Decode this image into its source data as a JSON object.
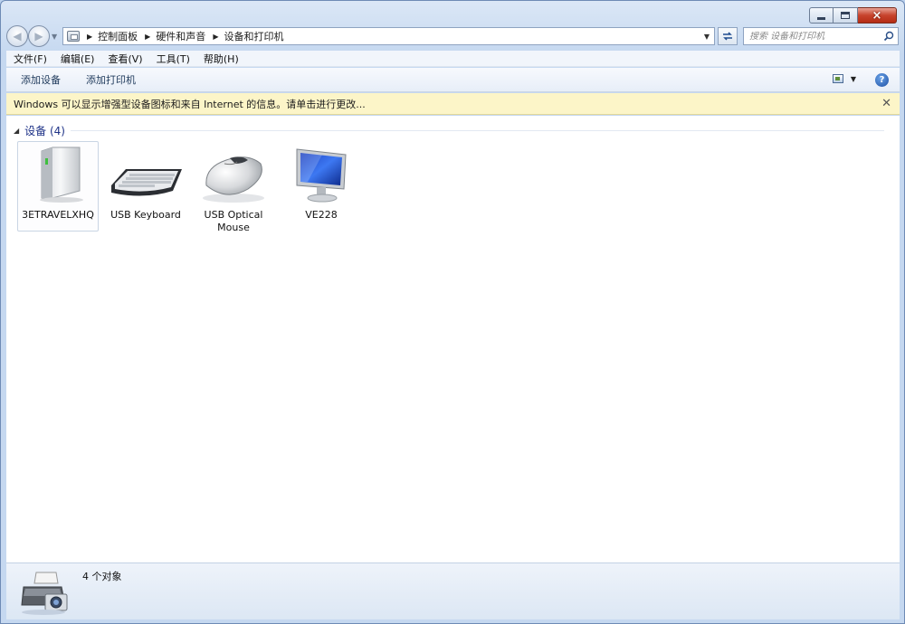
{
  "window": {
    "controls": {
      "minimize": "minimize",
      "maximize": "maximize",
      "close": "×"
    }
  },
  "address": {
    "breadcrumbs": [
      "控制面板",
      "硬件和声音",
      "设备和打印机"
    ],
    "search_placeholder": "搜索 设备和打印机"
  },
  "menu": {
    "items": [
      "文件(F)",
      "编辑(E)",
      "查看(V)",
      "工具(T)",
      "帮助(H)"
    ]
  },
  "commands": {
    "add_device": "添加设备",
    "add_printer": "添加打印机"
  },
  "info_bar": {
    "text": "Windows 可以显示增强型设备图标和来自 Internet 的信息。请单击进行更改..."
  },
  "group": {
    "title": "设备 (4)"
  },
  "devices": [
    {
      "label": "3ETRAVELXHQ",
      "icon": "external-drive-icon",
      "selected": true
    },
    {
      "label": "USB Keyboard",
      "icon": "keyboard-icon",
      "selected": false
    },
    {
      "label": "USB Optical Mouse",
      "icon": "mouse-icon",
      "selected": false
    },
    {
      "label": "VE228",
      "icon": "monitor-icon",
      "selected": false
    }
  ],
  "details": {
    "count_text": "4 个对象",
    "icon": "printer-camera-icon"
  },
  "colors": {
    "info_bar_bg": "#fcf5c8",
    "group_title": "#1e3287",
    "close_button": "#c7432c"
  }
}
